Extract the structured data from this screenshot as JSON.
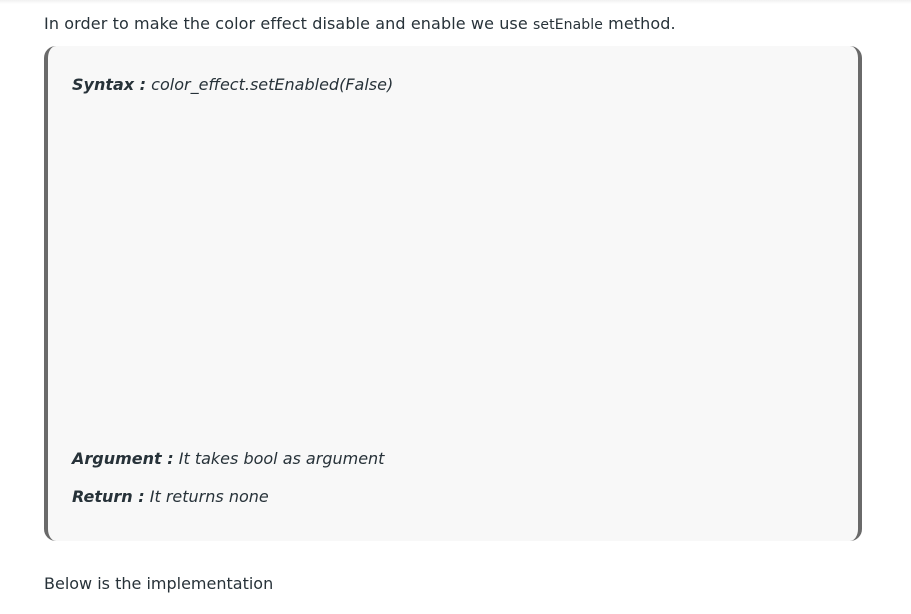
{
  "intro": {
    "text_before": "In order to make the color effect disable and enable we use ",
    "code": "setEnable",
    "text_after": " method."
  },
  "blockquote": {
    "syntax": {
      "label": "Syntax :",
      "value": "color_effect.setEnabled(False)"
    },
    "argument": {
      "label": "Argument :",
      "value": "It takes bool as argument"
    },
    "return": {
      "label": "Return :",
      "value": "It returns none"
    }
  },
  "outro": {
    "text": "Below is the implementation"
  }
}
